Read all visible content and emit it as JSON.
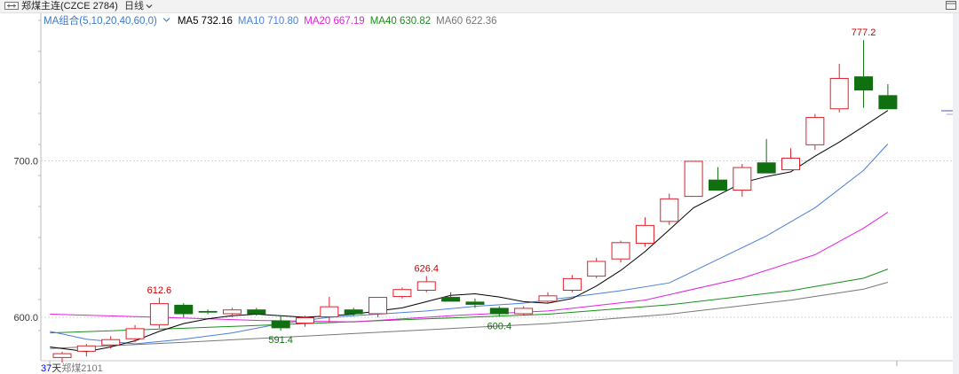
{
  "header": {
    "title": "郑煤主连(CZCE 2784)",
    "period": "日线"
  },
  "legend": {
    "group": "MA组合(5,10,20,40,60,0)",
    "items": [
      {
        "key": "ma5",
        "text": "MA5 732.16",
        "color": "#000000"
      },
      {
        "key": "ma10",
        "text": "MA10 710.80",
        "color": "#4a7fd8"
      },
      {
        "key": "ma20",
        "text": "MA20 667.19",
        "color": "#e020e0"
      },
      {
        "key": "ma40",
        "text": "MA40 630.82",
        "color": "#1a8f1a"
      },
      {
        "key": "ma60",
        "text": "MA60 622.36",
        "color": "#777777"
      }
    ]
  },
  "footer": {
    "count": "37",
    "unit": "天",
    "symbol": "郑煤2101"
  },
  "colors": {
    "up": "#e0202a",
    "down": "#107010",
    "grid": "#d4d4d4",
    "axis_label": "#333333"
  },
  "chart_data": {
    "type": "candlestick",
    "ylim": [
      571,
      792
    ],
    "y_ticks": [
      600,
      700
    ],
    "y_tick_labels": [
      "600.0",
      "700.0"
    ],
    "candles": [
      {
        "o": 574.0,
        "h": 578.0,
        "l": 571.0,
        "c": 577.0
      },
      {
        "o": 578.0,
        "h": 583.0,
        "l": 575.0,
        "c": 582.0
      },
      {
        "o": 582.0,
        "h": 588.0,
        "l": 580.0,
        "c": 586.0
      },
      {
        "o": 586.0,
        "h": 595.0,
        "l": 584.0,
        "c": 593.0
      },
      {
        "o": 595.0,
        "h": 612.6,
        "l": 593.0,
        "c": 609.0
      },
      {
        "o": 608.0,
        "h": 609.0,
        "l": 600.0,
        "c": 602.0
      },
      {
        "o": 604.0,
        "h": 605.0,
        "l": 602.0,
        "c": 603.0
      },
      {
        "o": 602.0,
        "h": 606.0,
        "l": 600.0,
        "c": 605.0
      },
      {
        "o": 605.0,
        "h": 606.0,
        "l": 601.0,
        "c": 602.0
      },
      {
        "o": 598.0,
        "h": 601.0,
        "l": 591.4,
        "c": 593.0
      },
      {
        "o": 596.0,
        "h": 601.0,
        "l": 594.0,
        "c": 600.0
      },
      {
        "o": 600.0,
        "h": 613.0,
        "l": 597.0,
        "c": 607.0
      },
      {
        "o": 605.0,
        "h": 606.0,
        "l": 601.0,
        "c": 602.0
      },
      {
        "o": 602.0,
        "h": 613.0,
        "l": 600.0,
        "c": 613.0
      },
      {
        "o": 613.0,
        "h": 619.0,
        "l": 612.0,
        "c": 618.0
      },
      {
        "o": 617.0,
        "h": 626.4,
        "l": 616.0,
        "c": 623.0
      },
      {
        "o": 613.0,
        "h": 616.0,
        "l": 610.0,
        "c": 610.0
      },
      {
        "o": 610.0,
        "h": 612.0,
        "l": 606.0,
        "c": 608.0
      },
      {
        "o": 606.0,
        "h": 607.0,
        "l": 600.4,
        "c": 602.0
      },
      {
        "o": 602.0,
        "h": 607.0,
        "l": 601.0,
        "c": 606.0
      },
      {
        "o": 610.0,
        "h": 616.0,
        "l": 609.0,
        "c": 614.0
      },
      {
        "o": 617.0,
        "h": 627.0,
        "l": 616.0,
        "c": 625.0
      },
      {
        "o": 626.0,
        "h": 638.0,
        "l": 625.0,
        "c": 636.0
      },
      {
        "o": 637.0,
        "h": 649.0,
        "l": 635.0,
        "c": 648.0
      },
      {
        "o": 647.0,
        "h": 664.0,
        "l": 645.0,
        "c": 659.0
      },
      {
        "o": 661.0,
        "h": 679.0,
        "l": 659.0,
        "c": 676.0
      },
      {
        "o": 677.0,
        "h": 700.0,
        "l": 677.0,
        "c": 700.0
      },
      {
        "o": 688.0,
        "h": 696.0,
        "l": 681.0,
        "c": 681.0
      },
      {
        "o": 681.0,
        "h": 698.0,
        "l": 677.0,
        "c": 696.0
      },
      {
        "o": 699.0,
        "h": 714.0,
        "l": 692.0,
        "c": 692.0
      },
      {
        "o": 694.0,
        "h": 708.0,
        "l": 694.0,
        "c": 702.0
      },
      {
        "o": 710.0,
        "h": 730.0,
        "l": 707.0,
        "c": 728.0
      },
      {
        "o": 733.0,
        "h": 762.0,
        "l": 731.0,
        "c": 753.0
      },
      {
        "o": 754.0,
        "h": 777.2,
        "l": 734.0,
        "c": 745.0
      },
      {
        "o": 742.0,
        "h": 749.0,
        "l": 733.0,
        "c": 733.0
      }
    ],
    "annotations": [
      {
        "index": 4,
        "value": 612.6,
        "text": "612.6",
        "position": "above",
        "color": "#cc0000"
      },
      {
        "index": 9,
        "value": 591.4,
        "text": "591.4",
        "position": "below",
        "color": "#107010"
      },
      {
        "index": 15,
        "value": 626.4,
        "text": "626.4",
        "position": "above",
        "color": "#cc0000"
      },
      {
        "index": 18,
        "value": 600.4,
        "text": "600.4",
        "position": "below",
        "color": "#107010"
      },
      {
        "index": 33,
        "value": 777.2,
        "text": "777.2",
        "position": "above",
        "color": "#cc0000"
      }
    ],
    "ma_lines": [
      {
        "name": "MA5",
        "color": "#000000",
        "points": [
          [
            -0.5,
            581
          ],
          [
            1,
            578
          ],
          [
            2,
            581
          ],
          [
            3,
            585
          ],
          [
            4,
            591
          ],
          [
            5,
            596
          ],
          [
            6,
            599
          ],
          [
            7,
            601
          ],
          [
            8,
            602
          ],
          [
            9,
            601
          ],
          [
            10,
            600
          ],
          [
            11,
            601
          ],
          [
            12,
            602
          ],
          [
            13,
            604
          ],
          [
            14,
            606
          ],
          [
            15,
            610
          ],
          [
            16,
            614
          ],
          [
            17,
            615
          ],
          [
            18,
            613
          ],
          [
            19,
            610
          ],
          [
            20,
            609
          ],
          [
            21,
            612
          ],
          [
            22,
            620
          ],
          [
            23,
            630
          ],
          [
            24,
            642
          ],
          [
            25,
            656
          ],
          [
            26,
            670
          ],
          [
            27,
            678
          ],
          [
            28,
            686
          ],
          [
            29,
            690
          ],
          [
            30,
            693
          ],
          [
            31,
            703
          ],
          [
            32,
            712
          ],
          [
            33,
            722
          ],
          [
            34,
            732.16
          ]
        ]
      },
      {
        "name": "MA10",
        "color": "#4a7fd8",
        "points": [
          [
            -0.5,
            591
          ],
          [
            1,
            586
          ],
          [
            3,
            583
          ],
          [
            5,
            586
          ],
          [
            7,
            590
          ],
          [
            9,
            596
          ],
          [
            11,
            600
          ],
          [
            13,
            602
          ],
          [
            15,
            604
          ],
          [
            17,
            607
          ],
          [
            19,
            609
          ],
          [
            21,
            613
          ],
          [
            23,
            617
          ],
          [
            25,
            622
          ],
          [
            27,
            637
          ],
          [
            29,
            652
          ],
          [
            31,
            670
          ],
          [
            33,
            694
          ],
          [
            34,
            710.8
          ]
        ]
      },
      {
        "name": "MA20",
        "color": "#e020e0",
        "points": [
          [
            -0.5,
            602
          ],
          [
            4,
            600
          ],
          [
            8,
            598
          ],
          [
            12,
            597
          ],
          [
            16,
            601
          ],
          [
            20,
            604
          ],
          [
            24,
            611
          ],
          [
            28,
            625
          ],
          [
            31,
            640
          ],
          [
            33,
            657
          ],
          [
            34,
            667.19
          ]
        ]
      },
      {
        "name": "MA40",
        "color": "#1a8f1a",
        "points": [
          [
            -0.5,
            590
          ],
          [
            5,
            593
          ],
          [
            10,
            596
          ],
          [
            15,
            599
          ],
          [
            20,
            602
          ],
          [
            25,
            608
          ],
          [
            30,
            617
          ],
          [
            33,
            625
          ],
          [
            34,
            630.82
          ]
        ]
      },
      {
        "name": "MA60",
        "color": "#777777",
        "points": [
          [
            -0.5,
            580
          ],
          [
            5,
            584
          ],
          [
            10,
            588
          ],
          [
            15,
            592
          ],
          [
            20,
            596
          ],
          [
            25,
            602
          ],
          [
            30,
            611
          ],
          [
            33,
            618
          ],
          [
            34,
            622.36
          ]
        ]
      }
    ],
    "current_price_marker": {
      "value": 732
    }
  }
}
